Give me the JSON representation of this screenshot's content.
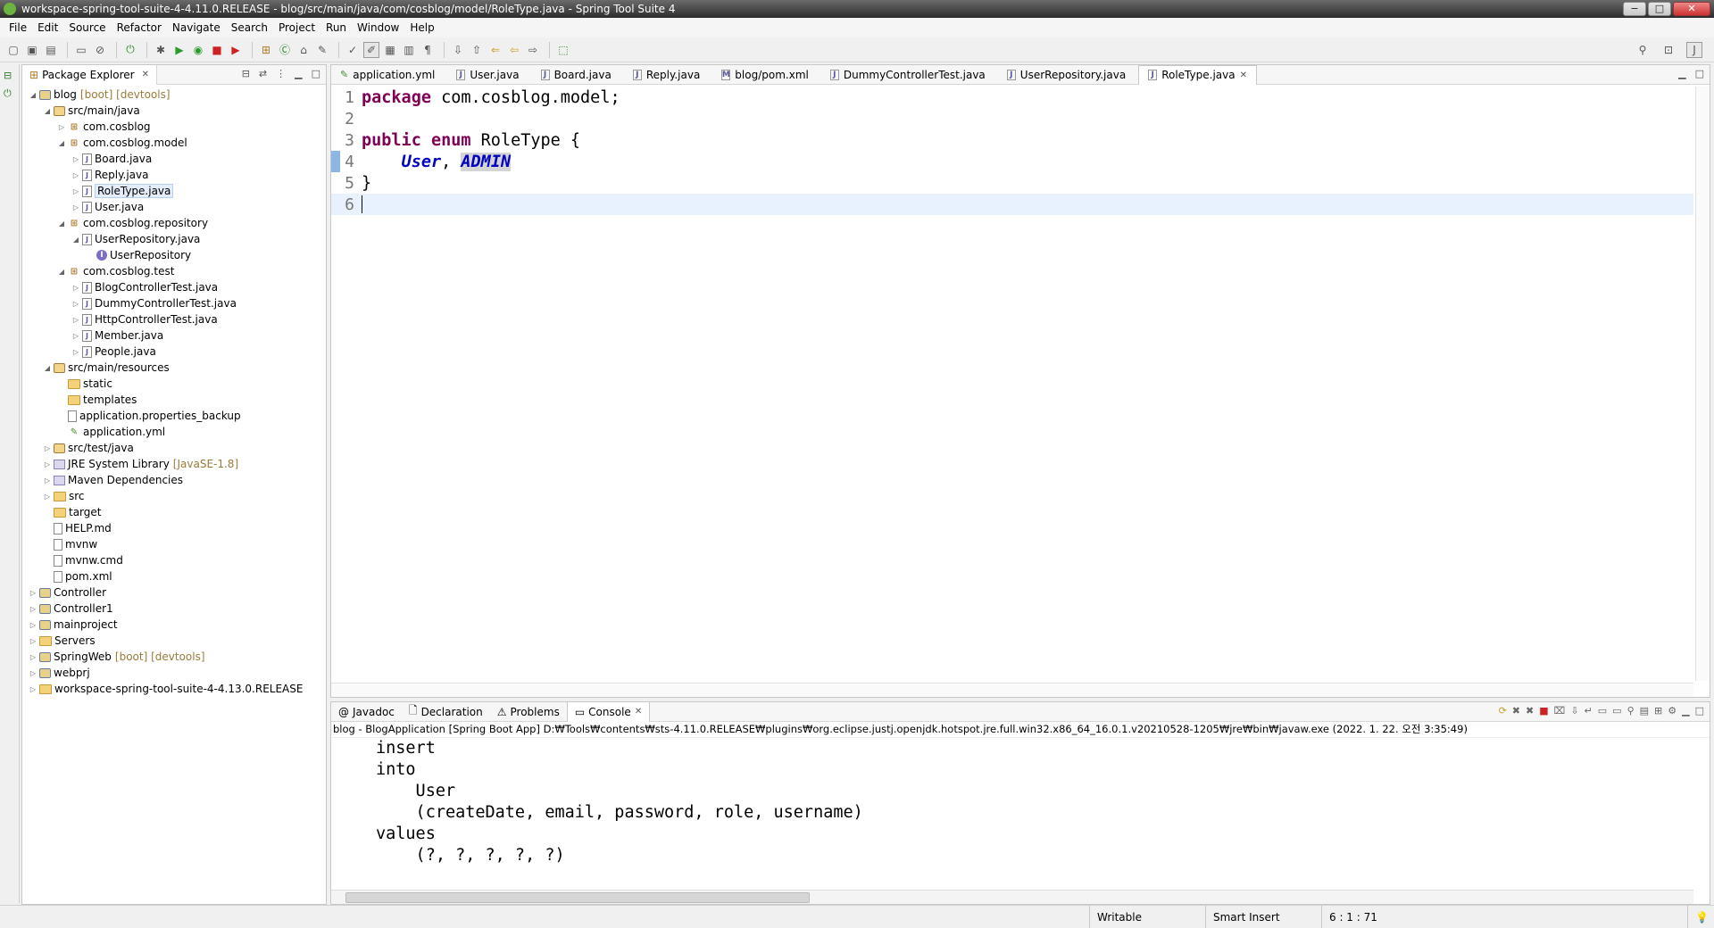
{
  "window": {
    "title": "workspace-spring-tool-suite-4-4.11.0.RELEASE - blog/src/main/java/com/cosblog/model/RoleType.java - Spring Tool Suite 4",
    "controls": [
      "−",
      "□",
      "✕"
    ]
  },
  "menu": [
    "File",
    "Edit",
    "Source",
    "Refactor",
    "Navigate",
    "Search",
    "Project",
    "Run",
    "Window",
    "Help"
  ],
  "package_explorer": {
    "title": "Package Explorer",
    "tree": [
      {
        "indent": 0,
        "tw": "◢",
        "icon": "proj",
        "label": "blog",
        "deco": "[boot] [devtools]"
      },
      {
        "indent": 1,
        "tw": "◢",
        "icon": "src",
        "label": "src/main/java"
      },
      {
        "indent": 2,
        "tw": "▷",
        "icon": "pkg",
        "label": "com.cosblog"
      },
      {
        "indent": 2,
        "tw": "◢",
        "icon": "pkg",
        "label": "com.cosblog.model"
      },
      {
        "indent": 3,
        "tw": "▷",
        "icon": "java",
        "label": "Board.java"
      },
      {
        "indent": 3,
        "tw": "▷",
        "icon": "java",
        "label": "Reply.java"
      },
      {
        "indent": 3,
        "tw": "▷",
        "icon": "java",
        "label": "RoleType.java",
        "selected": true
      },
      {
        "indent": 3,
        "tw": "▷",
        "icon": "java",
        "label": "User.java"
      },
      {
        "indent": 2,
        "tw": "◢",
        "icon": "pkg",
        "label": "com.cosblog.repository"
      },
      {
        "indent": 3,
        "tw": "◢",
        "icon": "java",
        "label": "UserRepository.java"
      },
      {
        "indent": 4,
        "tw": "",
        "icon": "iface",
        "label": "UserRepository"
      },
      {
        "indent": 2,
        "tw": "◢",
        "icon": "pkg",
        "label": "com.cosblog.test"
      },
      {
        "indent": 3,
        "tw": "▷",
        "icon": "java",
        "label": "BlogControllerTest.java"
      },
      {
        "indent": 3,
        "tw": "▷",
        "icon": "java",
        "label": "DummyControllerTest.java"
      },
      {
        "indent": 3,
        "tw": "▷",
        "icon": "java",
        "label": "HttpControllerTest.java"
      },
      {
        "indent": 3,
        "tw": "▷",
        "icon": "java",
        "label": "Member.java"
      },
      {
        "indent": 3,
        "tw": "▷",
        "icon": "java",
        "label": "People.java"
      },
      {
        "indent": 1,
        "tw": "◢",
        "icon": "src",
        "label": "src/main/resources"
      },
      {
        "indent": 2,
        "tw": "",
        "icon": "folder",
        "label": "static"
      },
      {
        "indent": 2,
        "tw": "",
        "icon": "folder",
        "label": "templates"
      },
      {
        "indent": 2,
        "tw": "",
        "icon": "file",
        "label": "application.properties_backup"
      },
      {
        "indent": 2,
        "tw": "",
        "icon": "yml",
        "label": "application.yml"
      },
      {
        "indent": 1,
        "tw": "▷",
        "icon": "src",
        "label": "src/test/java"
      },
      {
        "indent": 1,
        "tw": "▷",
        "icon": "lib",
        "label": "JRE System Library",
        "deco": "[JavaSE-1.8]"
      },
      {
        "indent": 1,
        "tw": "▷",
        "icon": "lib",
        "label": "Maven Dependencies"
      },
      {
        "indent": 1,
        "tw": "▷",
        "icon": "folder",
        "label": "src"
      },
      {
        "indent": 1,
        "tw": "",
        "icon": "folder",
        "label": "target"
      },
      {
        "indent": 1,
        "tw": "",
        "icon": "file",
        "label": "HELP.md"
      },
      {
        "indent": 1,
        "tw": "",
        "icon": "file",
        "label": "mvnw"
      },
      {
        "indent": 1,
        "tw": "",
        "icon": "file",
        "label": "mvnw.cmd"
      },
      {
        "indent": 1,
        "tw": "",
        "icon": "file",
        "label": "pom.xml"
      },
      {
        "indent": 0,
        "tw": "▷",
        "icon": "proj",
        "label": "Controller"
      },
      {
        "indent": 0,
        "tw": "▷",
        "icon": "proj",
        "label": "Controller1"
      },
      {
        "indent": 0,
        "tw": "▷",
        "icon": "proj",
        "label": "mainproject"
      },
      {
        "indent": 0,
        "tw": "▷",
        "icon": "folder",
        "label": "Servers"
      },
      {
        "indent": 0,
        "tw": "▷",
        "icon": "proj",
        "label": "SpringWeb",
        "deco": "[boot] [devtools]"
      },
      {
        "indent": 0,
        "tw": "▷",
        "icon": "proj",
        "label": "webprj"
      },
      {
        "indent": 0,
        "tw": "▷",
        "icon": "folder",
        "label": "workspace-spring-tool-suite-4-4.13.0.RELEASE"
      }
    ]
  },
  "editor": {
    "tabs": [
      {
        "label": "application.yml",
        "icon": "yml"
      },
      {
        "label": "User.java",
        "icon": "java"
      },
      {
        "label": "Board.java",
        "icon": "java"
      },
      {
        "label": "Reply.java",
        "icon": "java"
      },
      {
        "label": "blog/pom.xml",
        "icon": "xml"
      },
      {
        "label": "DummyControllerTest.java",
        "icon": "java"
      },
      {
        "label": "UserRepository.java",
        "icon": "java"
      },
      {
        "label": "RoleType.java",
        "icon": "java",
        "active": true
      }
    ],
    "code": {
      "l1": {
        "n": "1",
        "kw": "package",
        "rest": " com.cosblog.model;"
      },
      "l2": {
        "n": "2"
      },
      "l3": {
        "n": "3",
        "kw1": "public",
        "kw2": "enum",
        "rest": " RoleType {"
      },
      "l4": {
        "n": "4",
        "c1": "User",
        "sep": ", ",
        "c2": "ADMIN"
      },
      "l5": {
        "n": "5",
        "rest": "}"
      },
      "l6": {
        "n": "6"
      }
    }
  },
  "console": {
    "tabs": [
      {
        "label": "Javadoc",
        "icon": "@"
      },
      {
        "label": "Declaration",
        "icon": "🗋"
      },
      {
        "label": "Problems",
        "icon": "⚠"
      },
      {
        "label": "Console",
        "icon": "▭",
        "active": true
      }
    ],
    "header": "blog - BlogApplication [Spring Boot App] D:₩Tools₩contents₩sts-4.11.0.RELEASE₩plugins₩org.eclipse.justj.openjdk.hotspot.jre.full.win32.x86_64_16.0.1.v20210528-1205₩jre₩bin₩javaw.exe  (2022. 1. 22. 오전 3:35:49)",
    "output": [
      "insert",
      "into",
      "    User",
      "    (createDate, email, password, role, username)",
      "values",
      "    (?, ?, ?, ?, ?)"
    ]
  },
  "status": {
    "writable": "Writable",
    "insert_mode": "Smart Insert",
    "position": "6 : 1 : 71"
  }
}
